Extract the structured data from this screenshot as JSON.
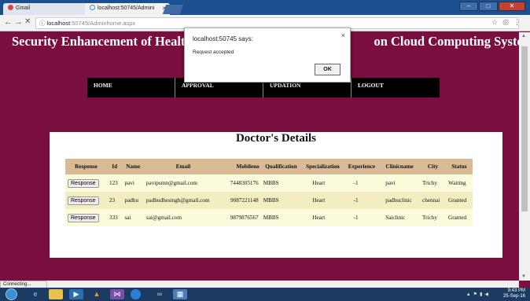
{
  "browser": {
    "tabs": [
      {
        "label": "Gmail",
        "active": false
      },
      {
        "label": "localhost:50745/Admini",
        "active": true
      }
    ],
    "url_host": "localhost",
    "url_path": ":50745/Adminhome.aspx",
    "status": "Connecting..."
  },
  "page": {
    "title_left": "Security Enhancement of Healt",
    "title_right": "on Cloud Computing System",
    "menu": [
      {
        "label": "HOME"
      },
      {
        "label": "APPROVAL"
      },
      {
        "label": "UPDATION"
      },
      {
        "label": "LOGOUT"
      }
    ],
    "section_title": "Doctor's Details",
    "table": {
      "headers": [
        "Response",
        "Id",
        "Name",
        "Email",
        "Mobileno",
        "Qualification",
        "Specialization",
        "Experience",
        "Clinicname",
        "City",
        "Status"
      ],
      "button_label": "Response",
      "rows": [
        {
          "id": "123",
          "name": "pavi",
          "email": "pavipsmn@gmail.com",
          "mobile": "7448305176",
          "qualification": "MBBS",
          "specialization": "Heart",
          "experience": "-1",
          "clinic": "pavi",
          "city": "Trichy",
          "status": "Waiting"
        },
        {
          "id": "23",
          "name": "padhu",
          "email": "padhudhesingh@gmail.com",
          "mobile": "9087221148",
          "qualification": "MBBS",
          "specialization": "Heart",
          "experience": "-1",
          "clinic": "padhuclinic",
          "city": "chennai",
          "status": "Granted"
        },
        {
          "id": "333",
          "name": "sai",
          "email": "sai@gmail.com",
          "mobile": "9879876567",
          "qualification": "MBBS",
          "specialization": "Heart",
          "experience": "-1",
          "clinic": "Saiclinic",
          "city": "Trichy",
          "status": "Granted"
        }
      ]
    }
  },
  "dialog": {
    "title": "localhost:50745 says:",
    "message": "Request accepted",
    "ok_label": "OK"
  },
  "taskbar": {
    "time": "9:43 PM",
    "date": "25-Sep-16"
  },
  "colors": {
    "page_bg": "#7a0f3f",
    "menu_bg": "#000000",
    "table_header": "#d8ba96",
    "row_odd": "#fbfbdc",
    "row_even": "#f3eec2"
  }
}
